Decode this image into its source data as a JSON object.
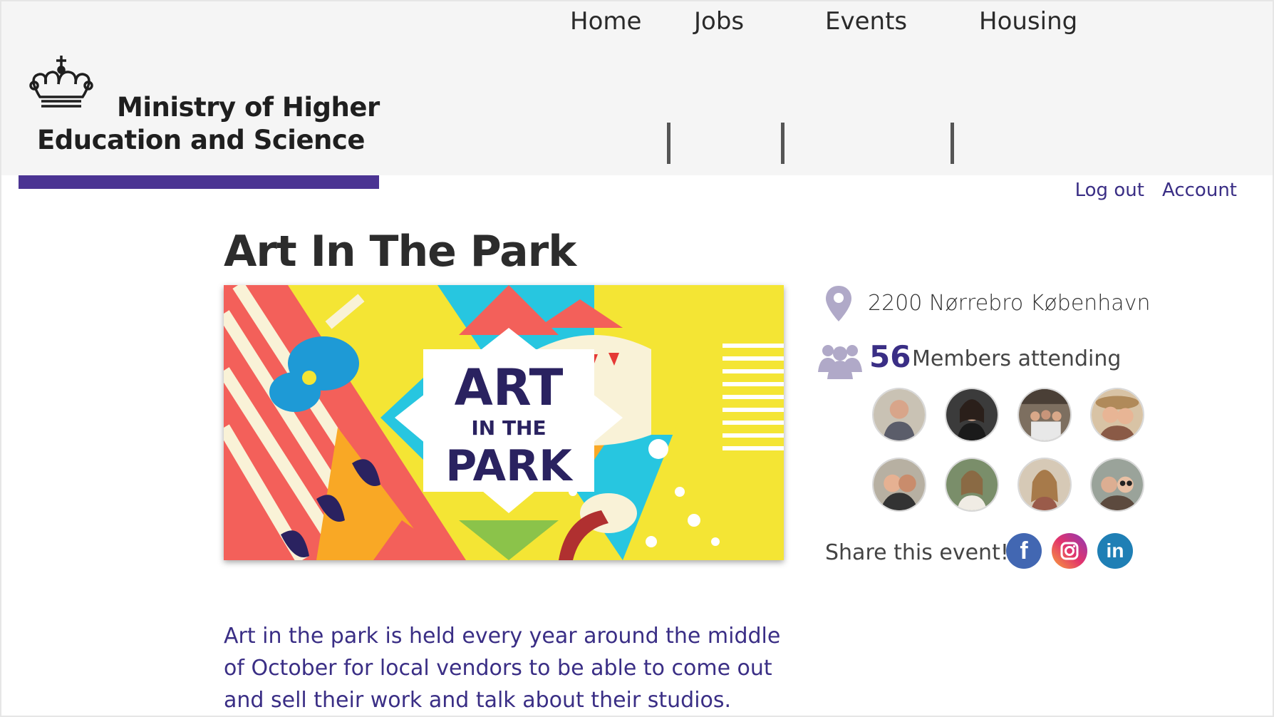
{
  "header": {
    "logo_line1": "Ministry of Higher",
    "logo_line2": "Education and Science",
    "nav": [
      {
        "label": "Home"
      },
      {
        "label": "Jobs"
      },
      {
        "label": "Events"
      },
      {
        "label": "Housing"
      }
    ],
    "user_links": {
      "logout": "Log out",
      "account": "Account"
    }
  },
  "event": {
    "title": "Art In The Park",
    "banner": {
      "line1": "ART",
      "line2": "IN THE",
      "line3": "PARK"
    },
    "location": "2200 Nørrebro København",
    "attendees_count": "56",
    "attendees_label": "Members attending",
    "attendee_avatars": 8,
    "share_label": "Share this event!",
    "social": [
      {
        "name": "facebook-icon",
        "glyph": "f"
      },
      {
        "name": "instagram-icon",
        "glyph": ""
      },
      {
        "name": "linkedin-icon",
        "glyph": "in"
      }
    ],
    "description": "Art in the park is held every year around the middle of October for local vendors to be able to come out and sell their work and talk about their studios. There are"
  },
  "colors": {
    "brand_purple": "#3a2e85",
    "logo_bar": "#4b3493",
    "header_bg": "#f5f5f5"
  }
}
